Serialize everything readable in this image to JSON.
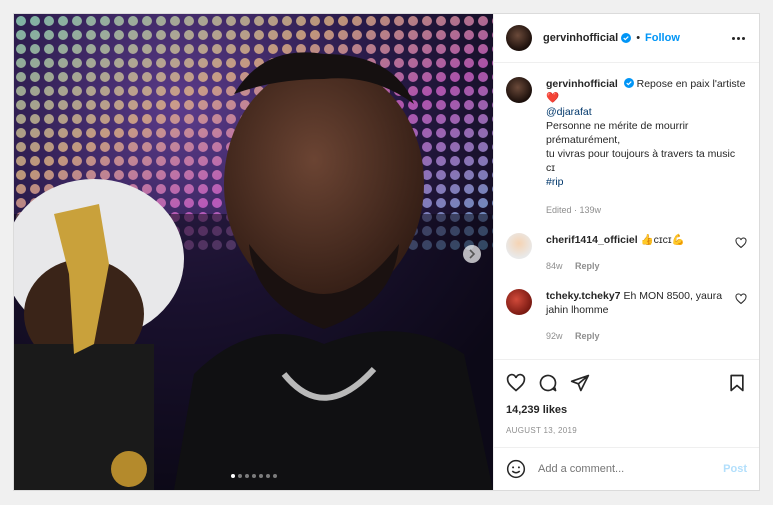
{
  "post": {
    "username": "gervinhofficial",
    "follow_label": "Follow",
    "separator": "•",
    "caption": {
      "text": "Repose en paix l'artiste",
      "heart": "❤️",
      "mention": "@djarafat",
      "line1": "Personne ne mérite de mourrir",
      "line2": "prématurément,",
      "line3": "tu vivras pour toujours à travers ta music",
      "line4": "ᴄɪ",
      "hashtag": "#rip",
      "meta": "Edited · 139w"
    },
    "comments": [
      {
        "username": "cherif1414_officiel",
        "text": "👍ᴄɪᴄɪ💪",
        "age": "84w",
        "reply_label": "Reply"
      },
      {
        "username": "tcheky.tcheky7",
        "text": "Eh MON 8500, yaura jahin lhomme",
        "age": "92w",
        "reply_label": "Reply"
      }
    ],
    "likes": "14,239 likes",
    "date": "AUGUST 13, 2019",
    "add_comment_placeholder": "Add a comment...",
    "post_label": "Post",
    "carousel": {
      "total": 7,
      "active": 1
    }
  },
  "colors": {
    "accent": "#0095f6",
    "verified": "#0095f6",
    "heart": "#ed4956"
  },
  "icons": [
    "verified-badge-icon",
    "more-options-icon",
    "heart-icon",
    "comment-icon",
    "share-icon",
    "bookmark-icon",
    "emoji-icon",
    "chevron-right-icon"
  ]
}
